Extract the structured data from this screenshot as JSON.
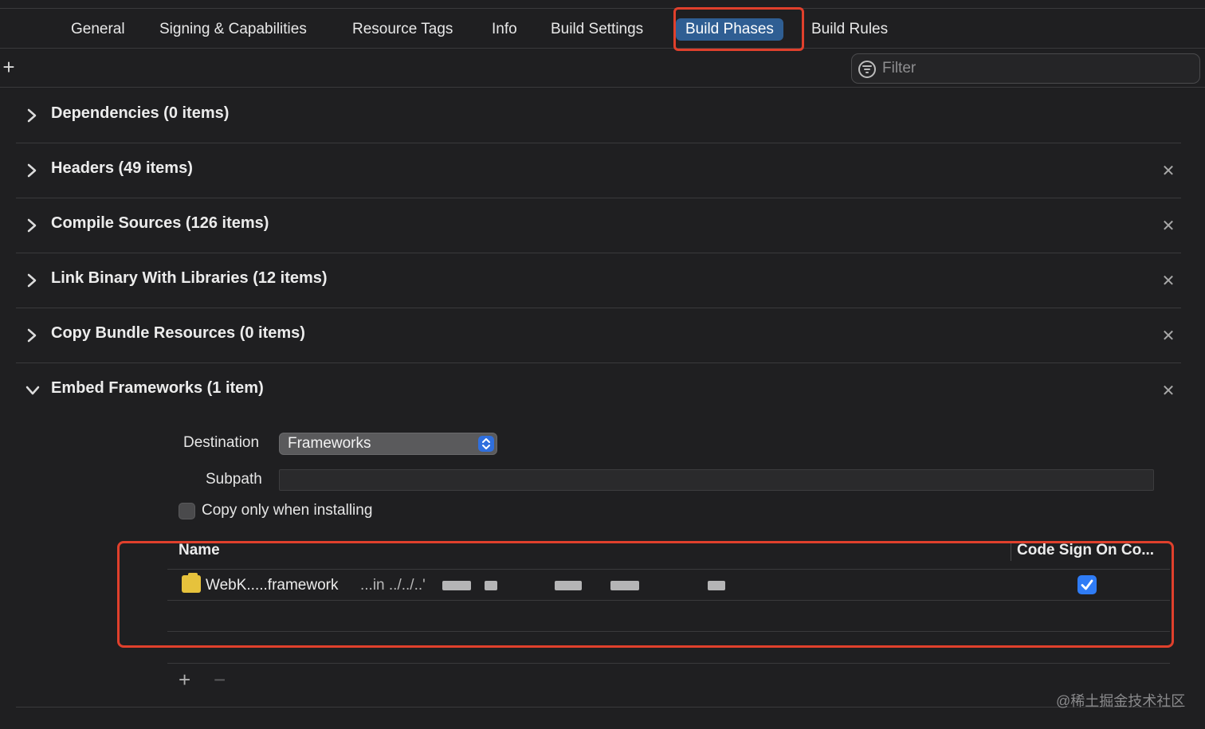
{
  "tabs": [
    {
      "label": "General",
      "active": false
    },
    {
      "label": "Signing & Capabilities",
      "active": false
    },
    {
      "label": "Resource Tags",
      "active": false
    },
    {
      "label": "Info",
      "active": false
    },
    {
      "label": "Build Settings",
      "active": false
    },
    {
      "label": "Build Phases",
      "active": true
    },
    {
      "label": "Build Rules",
      "active": false
    }
  ],
  "toolbar": {
    "filter_placeholder": "Filter"
  },
  "phases": [
    {
      "title": "Dependencies (0 items)",
      "expanded": false,
      "removable": false
    },
    {
      "title": "Headers (49 items)",
      "expanded": false,
      "removable": true
    },
    {
      "title": "Compile Sources (126 items)",
      "expanded": false,
      "removable": true
    },
    {
      "title": "Link Binary With Libraries (12 items)",
      "expanded": false,
      "removable": true
    },
    {
      "title": "Copy Bundle Resources (0 items)",
      "expanded": false,
      "removable": true
    },
    {
      "title": "Embed Frameworks (1 item)",
      "expanded": true,
      "removable": true
    }
  ],
  "embed": {
    "destination_label": "Destination",
    "destination_value": "Frameworks",
    "subpath_label": "Subpath",
    "subpath_value": "",
    "copy_only_label": "Copy only when installing",
    "copy_only_checked": false,
    "table": {
      "col_name": "Name",
      "col_code_sign": "Code Sign On Co...",
      "rows": [
        {
          "name": "WebK.....framework",
          "path": "...in ../../..'",
          "code_sign": true
        }
      ]
    }
  },
  "watermark": "@稀土掘金技术社区",
  "colors": {
    "background": "#1f1f21",
    "active_tab": "#2f5e93",
    "highlight": "#e0402c",
    "checkbox_checked": "#2f7cf6",
    "framework_icon": "#e6c23c"
  }
}
